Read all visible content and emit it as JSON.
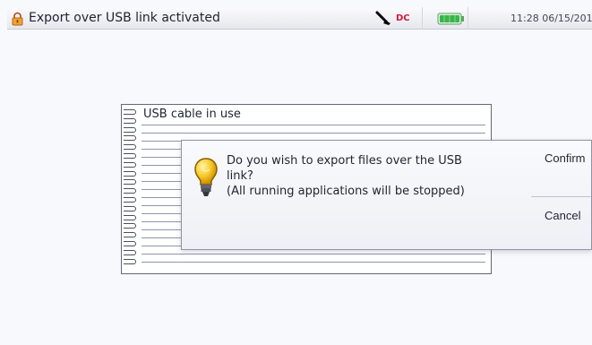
{
  "window": {
    "title": "Export over USB link activated",
    "time_date": "11:28 06/15/201"
  },
  "status": {
    "dc_label": "DC",
    "battery_color": "#39b54a"
  },
  "notebook": {
    "title": "USB cable in use"
  },
  "dialog": {
    "line1": "Do you wish to export files over the USB",
    "line2": "link?",
    "line3": "(All running applications will be stopped)",
    "confirm_label": "Confirm",
    "cancel_label": "Cancel"
  },
  "icons": {
    "title_icon": "lock-icon",
    "status_icon_1": "usb-plug-icon",
    "status_icon_2": "dc-icon",
    "status_icon_3": "battery-icon",
    "dialog_icon": "lightbulb-icon"
  }
}
